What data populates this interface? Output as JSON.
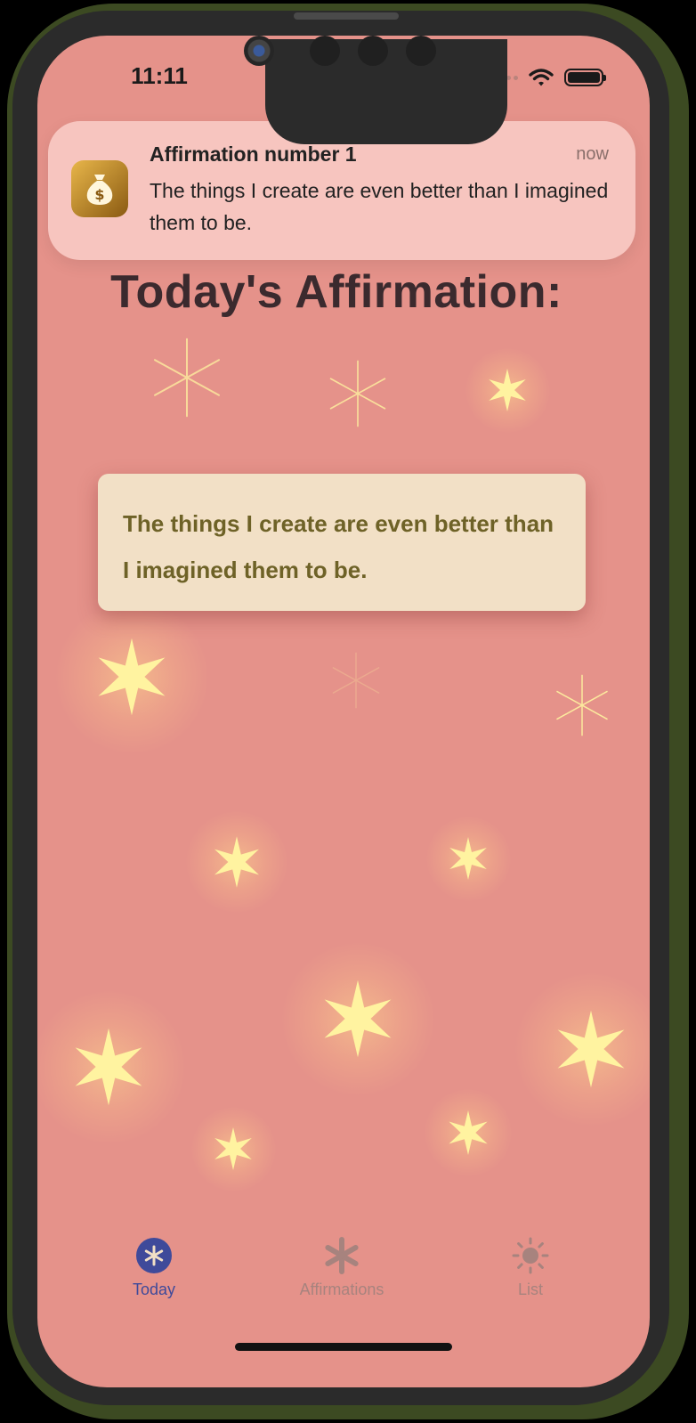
{
  "status_bar": {
    "time": "11:11"
  },
  "notification": {
    "app_icon": "money-bag-icon",
    "title": "Affirmation number 1",
    "time": "now",
    "body": "The things I create are even better than I imagined them to be."
  },
  "main": {
    "title": "Today's Affirmation:",
    "affirmation": "The things I create are even better than I imagined them to be."
  },
  "tab_bar": {
    "tabs": [
      {
        "label": "Today",
        "icon": "asterisk-circle-icon",
        "active": true
      },
      {
        "label": "Affirmations",
        "icon": "asterisk-icon",
        "active": false
      },
      {
        "label": "List",
        "icon": "sun-icon",
        "active": false
      }
    ]
  },
  "colors": {
    "background": "#e5928a",
    "card": "#f2e0c6",
    "card_text": "#6e6227",
    "sparkle": "#fff3a0",
    "active_tab": "#3f4a9a"
  }
}
